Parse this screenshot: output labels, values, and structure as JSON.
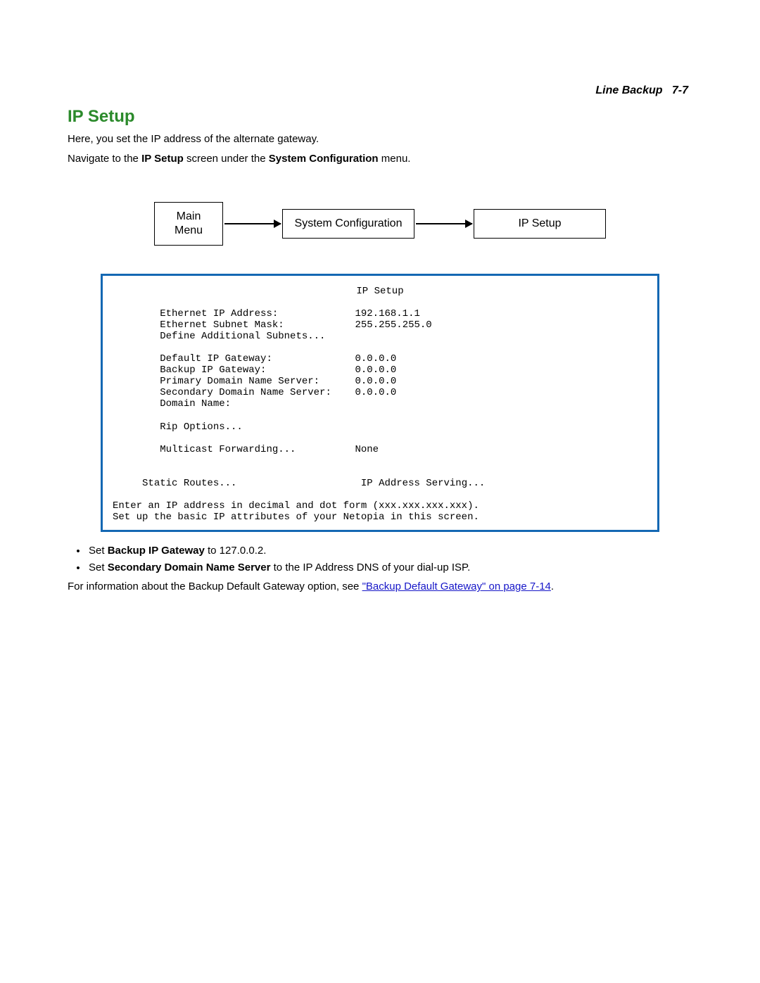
{
  "header": {
    "section": "Line Backup",
    "page": "7-7"
  },
  "title": "IP Setup",
  "intro1": "Here, you set the IP address of the alternate gateway.",
  "intro2_pre": "Navigate to the ",
  "intro2_b1": "IP Setup",
  "intro2_mid": " screen under the ",
  "intro2_b2": "System Configuration",
  "intro2_post": " menu.",
  "nav": {
    "box1_line1": "Main",
    "box1_line2": "Menu",
    "box2": "System Configuration",
    "box3": "IP Setup"
  },
  "terminal": {
    "title": "IP Setup",
    "eth_ip_label": "Ethernet IP Address:",
    "eth_ip_value": "192.168.1.1",
    "eth_mask_label": "Ethernet Subnet Mask:",
    "eth_mask_value": "255.255.255.0",
    "define_subnets": "Define Additional Subnets...",
    "def_gw_label": "Default IP Gateway:",
    "def_gw_value": "0.0.0.0",
    "bk_gw_label": "Backup IP Gateway:",
    "bk_gw_value": "0.0.0.0",
    "pdns_label": "Primary Domain Name Server:",
    "pdns_value": "0.0.0.0",
    "sdns_label": "Secondary Domain Name Server:",
    "sdns_value": "0.0.0.0",
    "domain_name": "Domain Name:",
    "rip": "Rip Options...",
    "mcast_label": "Multicast Forwarding...",
    "mcast_value": "None",
    "static_routes": "Static Routes...",
    "ip_serving": "IP Address Serving...",
    "help1": "Enter an IP address in decimal and dot form (xxx.xxx.xxx.xxx).",
    "help2": "Set up the basic IP attributes of your Netopia in this screen."
  },
  "bullets": {
    "b1_pre": "Set ",
    "b1_bold": "Backup IP Gateway",
    "b1_post": " to 127.0.0.2.",
    "b2_pre": "Set ",
    "b2_bold": "Secondary Domain Name Server",
    "b2_post": " to the IP Address DNS of your dial-up ISP."
  },
  "footer": {
    "pre": "For information about the Backup Default Gateway option, see ",
    "link": "\"Backup Default Gateway\" on page 7-14",
    "post": "."
  }
}
